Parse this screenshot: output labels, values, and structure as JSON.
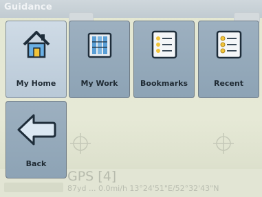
{
  "window": {
    "title": "Guidance"
  },
  "menu": {
    "items": [
      {
        "label": "My Home",
        "icon": "house-icon",
        "selected": true
      },
      {
        "label": "My Work",
        "icon": "office-building-icon",
        "selected": false
      },
      {
        "label": "Bookmarks",
        "icon": "bookmarks-list-icon",
        "selected": false
      },
      {
        "label": "Recent",
        "icon": "recent-list-icon",
        "selected": false
      }
    ],
    "back": {
      "label": "Back",
      "icon": "back-arrow-icon"
    }
  },
  "status": {
    "gps_title": "GPS [4]",
    "gps_details": "87yd ... 0.0mi/h   13°24'51\"E/52°32'43\"N"
  },
  "colors": {
    "tile": "#9db0c0",
    "tile_selected": "#cfdbe6",
    "map_background": "#e3e7d2"
  }
}
